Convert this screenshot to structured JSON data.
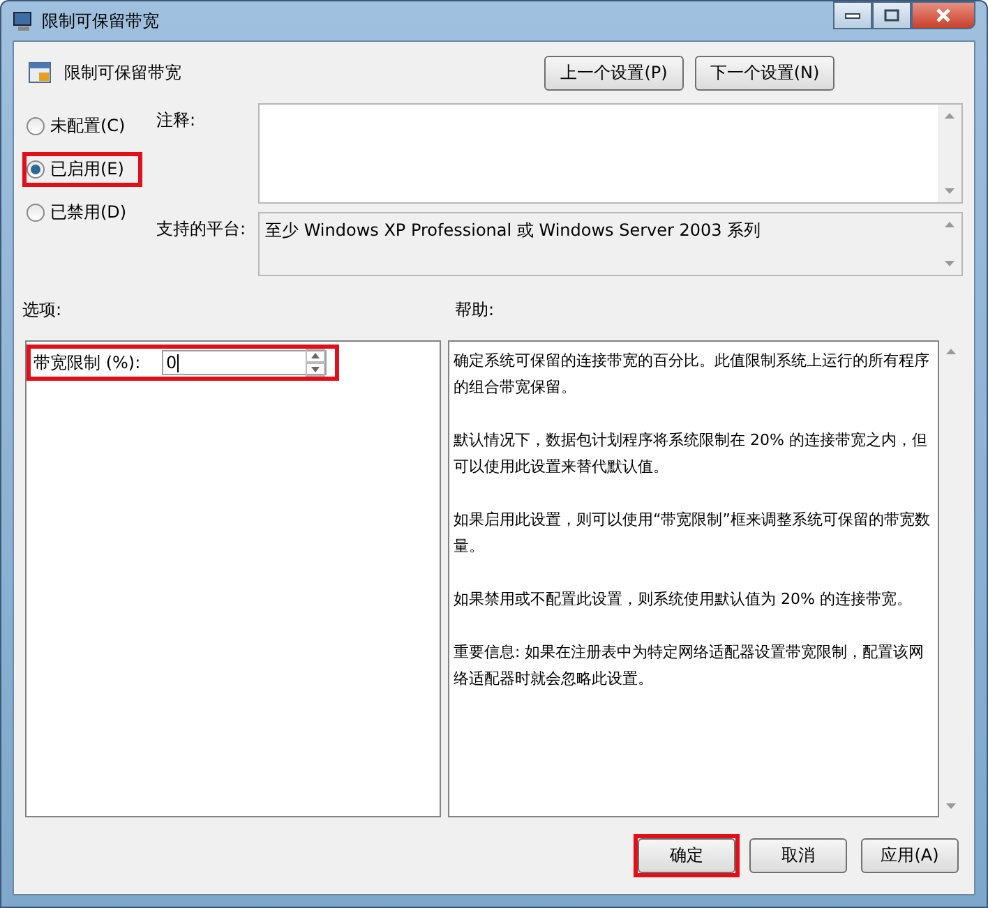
{
  "window": {
    "title": "限制可保留带宽"
  },
  "header": {
    "title": "限制可保留带宽"
  },
  "nav_buttons": [
    "上一个设置(P)",
    "下一个设置(N)"
  ],
  "radios": [
    {
      "label": "未配置(C)",
      "selected": false,
      "highlighted": false
    },
    {
      "label": "已启用(E)",
      "selected": true,
      "highlighted": true
    },
    {
      "label": "已禁用(D)",
      "selected": false,
      "highlighted": false
    }
  ],
  "comment": {
    "label": "注释:"
  },
  "platform": {
    "label": "支持的平台:",
    "value": "至少 Windows XP Professional 或 Windows Server 2003 系列"
  },
  "options": {
    "label": "选项:",
    "field_label": "带宽限制 (%):",
    "value": "0",
    "highlighted": true
  },
  "help": {
    "label": "帮助:",
    "paragraphs": [
      "确定系统可保留的连接带宽的百分比。此值限制系统上运行的所有程序的组合带宽保留。",
      "默认情况下，数据包计划程序将系统限制在 20% 的连接带宽之内，但可以使用此设置来替代默认值。",
      "如果启用此设置，则可以使用“带宽限制”框来调整系统可保留的带宽数量。",
      "如果禁用或不配置此设置，则系统使用默认值为 20% 的连接带宽。",
      "重要信息: 如果在注册表中为特定网络适配器设置带宽限制，配置该网络适配器时就会忽略此设置。"
    ]
  },
  "buttons": [
    {
      "label": "确定",
      "highlighted": true
    },
    {
      "label": "取消",
      "highlighted": false
    },
    {
      "label": "应用(A)",
      "highlighted": false
    }
  ]
}
